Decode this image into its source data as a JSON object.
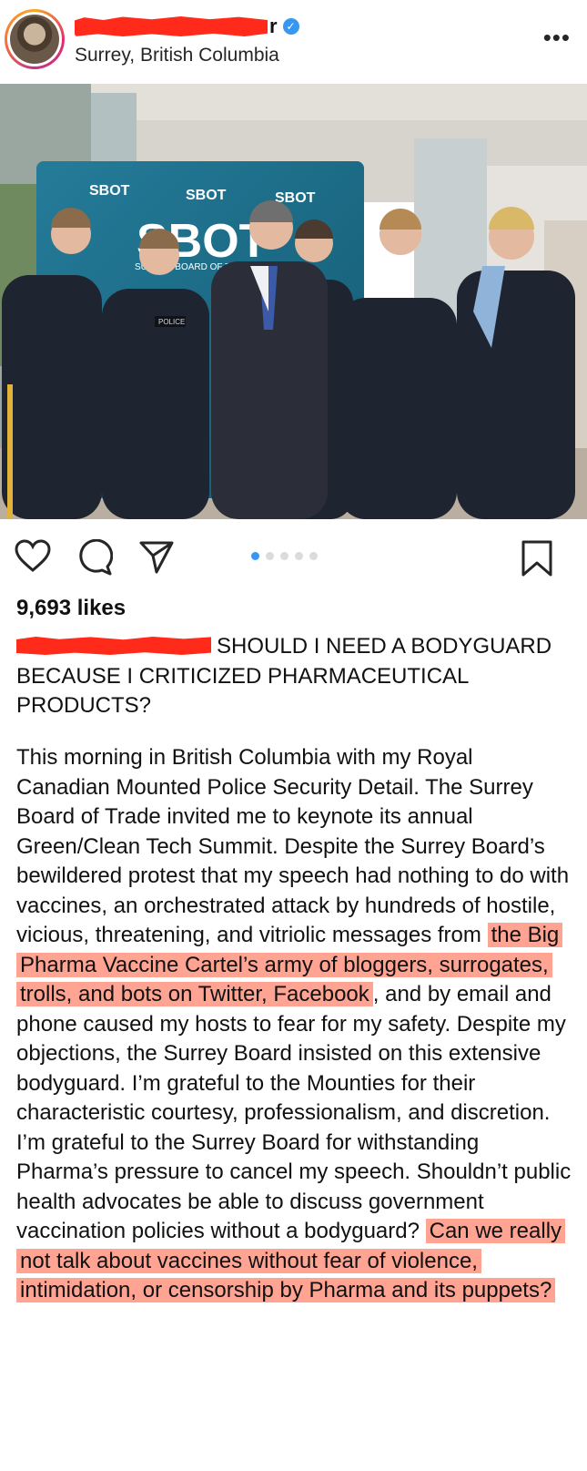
{
  "header": {
    "username_visible_tail": "r",
    "location": "Surrey, British Columbia",
    "more_icon": "more-horizontal-icon"
  },
  "photo": {
    "banner_text_top": [
      "SBOT",
      "SBOT",
      "SBOT"
    ],
    "banner_logo": "SBOT",
    "banner_subtitle": "SURREY BOARD OF TRADE",
    "police_badge": "POLICE"
  },
  "actions": {
    "icons": [
      "heart-icon",
      "comment-icon",
      "share-icon",
      "bookmark-icon"
    ],
    "carousel_count": 5,
    "carousel_active_index": 0
  },
  "likes_text": "9,693 likes",
  "caption": {
    "headline": "SHOULD I NEED A BODYGUARD BECAUSE I CRITICIZED PHARMACEUTICAL PRODUCTS?"
  },
  "body": {
    "part1": "This morning in British Columbia with my Royal Canadian Mounted Police Security Detail. The Surrey Board of Trade invited me to keynote its annual Green/Clean Tech Summit. Despite the Surrey Board’s bewildered protest that my speech had nothing to do with vaccines, an orchestrated attack by hundreds of hostile, vicious, threatening, and vitriolic messages from ",
    "highlight1": "the Big Pharma Vaccine Cartel’s army of bloggers, surrogates, trolls, and bots on Twitter, Facebook",
    "part2": ", and by email and phone caused my hosts to fear for my safety. Despite my objections, the Surrey Board insisted on this extensive bodyguard. I’m grateful to the Mounties for their characteristic courtesy, professionalism, and discretion. I’m grateful to the Surrey Board for withstanding Pharma’s pressure to cancel my speech. Shouldn’t public health advocates be able to discuss government vaccination policies without a bodyguard? ",
    "highlight2": "Can we really not talk about vaccines without fear of violence, intimidation, or censorship by Pharma and its puppets?"
  },
  "colors": {
    "highlight": "#ffa493",
    "redaction": "#ff2a1a",
    "verified": "#3897f0"
  }
}
